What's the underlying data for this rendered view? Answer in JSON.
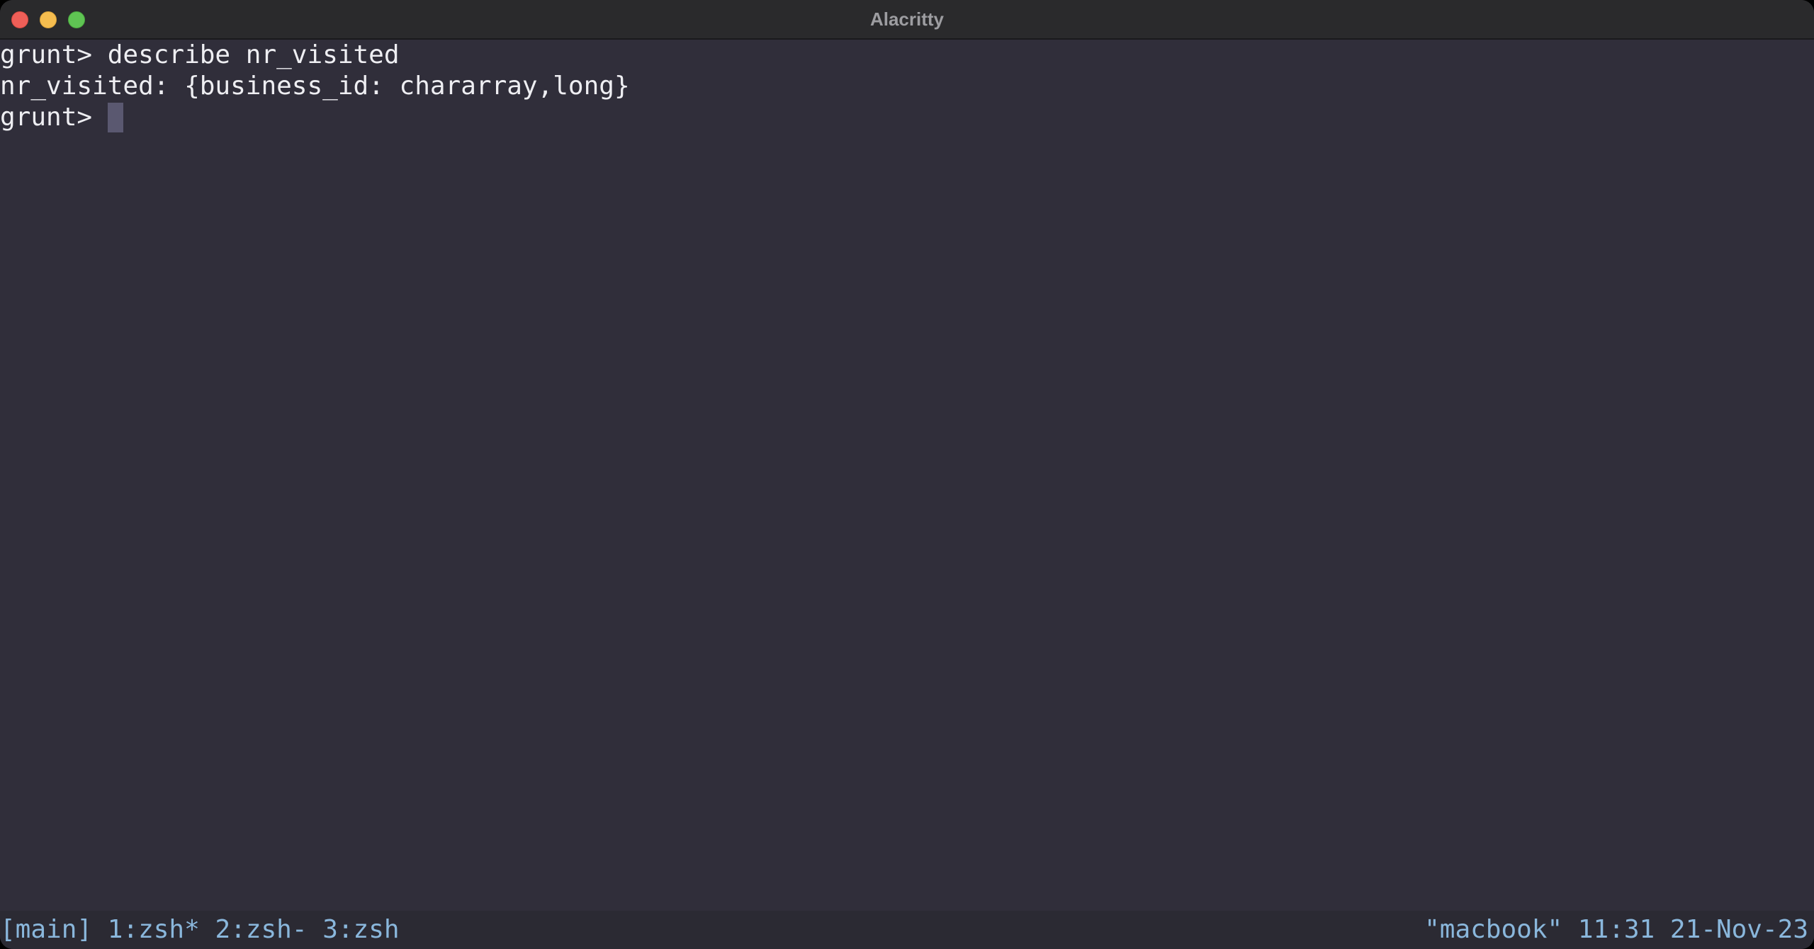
{
  "window": {
    "title": "Alacritty"
  },
  "terminal": {
    "lines": [
      "grunt> describe nr_visited",
      "nr_visited: {business_id: chararray,long}",
      "grunt> "
    ]
  },
  "tmux": {
    "session": "[main]",
    "windows": [
      {
        "label": "1:zsh*"
      },
      {
        "label": "2:zsh-"
      },
      {
        "label": "3:zsh"
      }
    ],
    "host": "\"macbook\"",
    "time": "11:31",
    "date": "21-Nov-23"
  },
  "colors": {
    "background": "#302e3a",
    "foreground": "#eeeef2",
    "status_text": "#8ab7dc",
    "cursor": "#5a5870"
  }
}
